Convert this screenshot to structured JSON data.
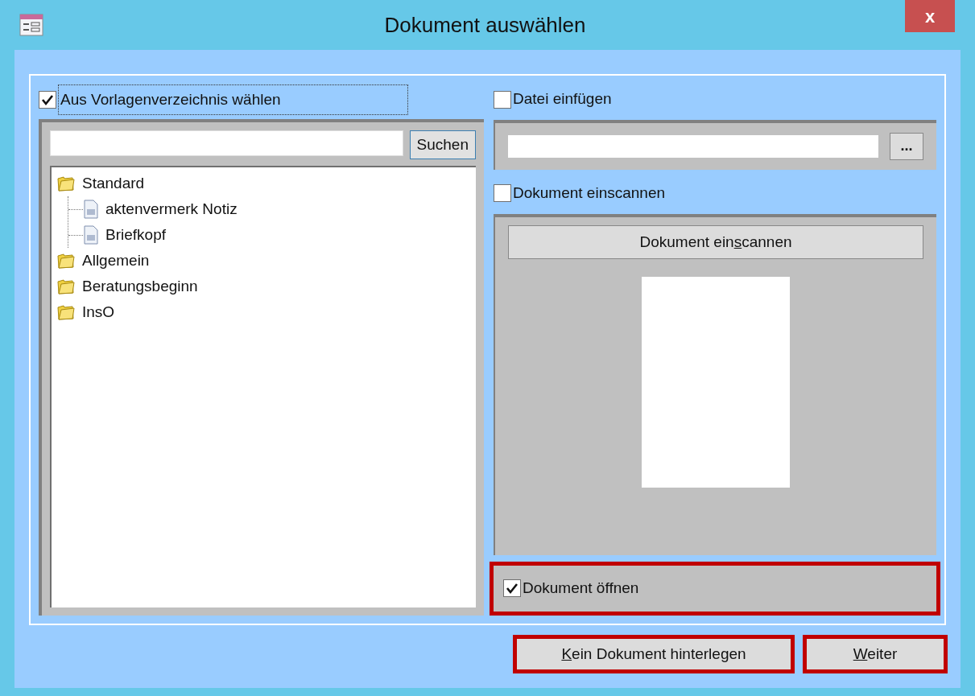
{
  "window": {
    "title": "Dokument auswählen",
    "close_label": "x"
  },
  "template_option": {
    "label": "Aus Vorlagenverzeichnis wählen",
    "checked": true,
    "focused": true
  },
  "search": {
    "button": "Suchen"
  },
  "tree": [
    {
      "label": "Standard",
      "kind": "folder",
      "children": [
        {
          "label": "aktenvermerk Notiz",
          "kind": "document"
        },
        {
          "label": "Briefkopf",
          "kind": "document"
        }
      ]
    },
    {
      "label": "Allgemein",
      "kind": "folder"
    },
    {
      "label": "Beratungsbeginn",
      "kind": "folder"
    },
    {
      "label": "InsO",
      "kind": "folder"
    }
  ],
  "file_option": {
    "label": "Datei einfügen",
    "checked": false,
    "browse_button": "..."
  },
  "scan_option": {
    "label": "Dokument einscannen",
    "checked": false,
    "button_parts": [
      {
        "text": "Dokument ein",
        "underlined": false
      },
      {
        "text": "s",
        "underlined": true
      },
      {
        "text": "cannen",
        "underlined": false
      }
    ]
  },
  "open_option": {
    "label": "Dokument öffnen",
    "checked": true,
    "highlighted": true
  },
  "buttons": [
    {
      "parts": [
        {
          "text": "K",
          "underlined": true
        },
        {
          "text": "ein Dokument hinterlegen",
          "underlined": false
        }
      ],
      "highlighted": true
    },
    {
      "parts": [
        {
          "text": "W",
          "underlined": true
        },
        {
          "text": "eiter",
          "underlined": false
        }
      ],
      "highlighted": true
    }
  ]
}
